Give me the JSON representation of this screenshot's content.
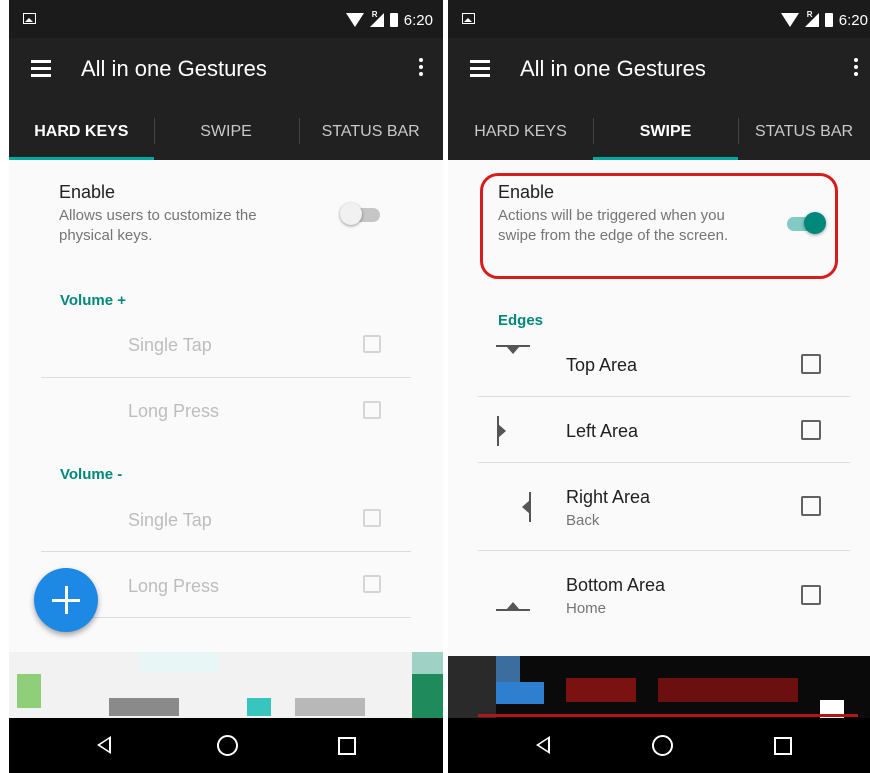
{
  "colors": {
    "accent": "#00897b",
    "tab_indicator": "#00a99d",
    "fab": "#1e88e5",
    "highlight": "#d81b1b"
  },
  "left": {
    "status_time": "6:20",
    "app_title": "All in one Gestures",
    "tabs": [
      {
        "label": "HARD KEYS",
        "active": true
      },
      {
        "label": "SWIPE",
        "active": false
      },
      {
        "label": "STATUS BAR",
        "active": false
      }
    ],
    "enable": {
      "title": "Enable",
      "desc": "Allows users to customize the physical keys.",
      "on": false
    },
    "sections": [
      {
        "label": "Volume +",
        "items": [
          {
            "label": "Single Tap",
            "checked": false
          },
          {
            "label": "Long Press",
            "checked": false
          }
        ]
      },
      {
        "label": "Volume -",
        "items": [
          {
            "label": "Single Tap",
            "checked": false
          },
          {
            "label": "Long Press",
            "checked": false
          }
        ]
      }
    ],
    "fab_icon": "plus-icon"
  },
  "right": {
    "status_time": "6:20",
    "app_title": "All in one Gestures",
    "tabs": [
      {
        "label": "HARD KEYS",
        "active": false
      },
      {
        "label": "SWIPE",
        "active": true
      },
      {
        "label": "STATUS BAR",
        "active": false
      }
    ],
    "enable": {
      "title": "Enable",
      "desc": "Actions will be triggered when you swipe from the edge of the screen.",
      "on": true
    },
    "edges_label": "Edges",
    "edges": [
      {
        "label": "Top Area",
        "sub": "",
        "icon": "top-edge-icon",
        "checked": false
      },
      {
        "label": "Left Area",
        "sub": "",
        "icon": "left-edge-icon",
        "checked": false
      },
      {
        "label": "Right Area",
        "sub": "Back",
        "icon": "right-edge-icon",
        "checked": false
      },
      {
        "label": "Bottom Area",
        "sub": "Home",
        "icon": "bottom-edge-icon",
        "checked": false
      }
    ]
  }
}
